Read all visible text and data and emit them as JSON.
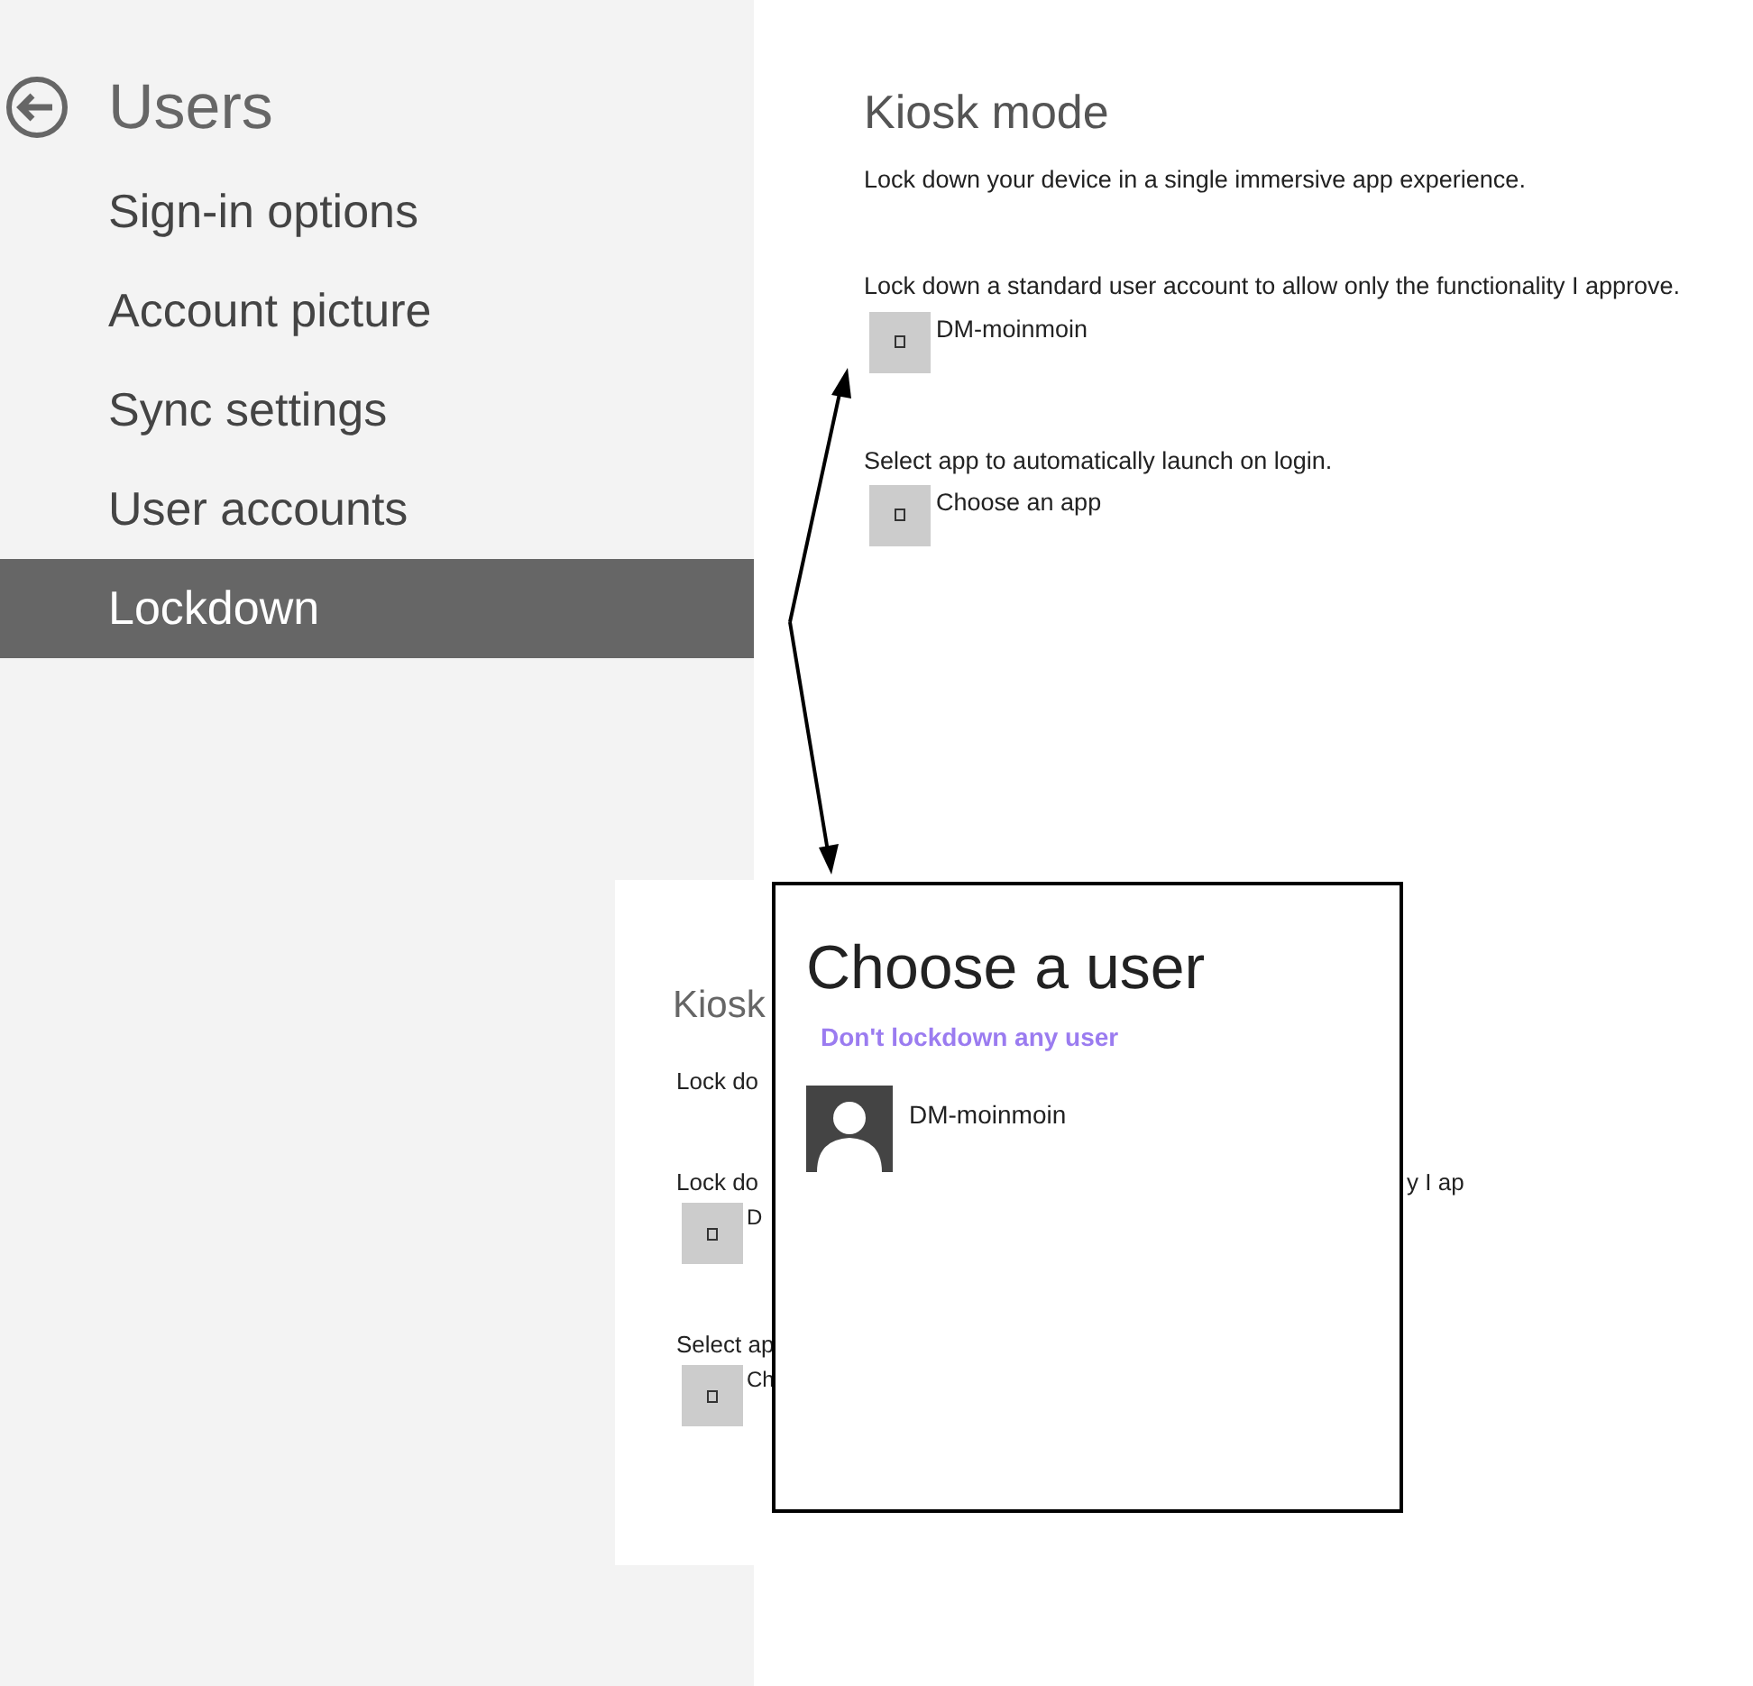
{
  "sidebar": {
    "title": "Users",
    "items": [
      {
        "label": "Sign-in options",
        "selected": false
      },
      {
        "label": "Account picture",
        "selected": false
      },
      {
        "label": "Sync settings",
        "selected": false
      },
      {
        "label": "User accounts",
        "selected": false
      },
      {
        "label": "Lockdown",
        "selected": true
      }
    ]
  },
  "main": {
    "title": "Kiosk mode",
    "description": "Lock down your device in a single immersive app experience.",
    "sections": [
      {
        "label": "Lock down a standard user account to allow only the functionality I approve.",
        "value": "DM-moinmoin"
      },
      {
        "label": "Select app to automatically launch on login.",
        "value": "Choose an app"
      }
    ]
  },
  "inset": {
    "title": "Kiosk",
    "description": "Lock do",
    "sections": [
      {
        "label": "Lock do",
        "label_tail": "y I ap",
        "value": "D"
      },
      {
        "label": "Select ap",
        "value": "Ch"
      }
    ]
  },
  "popup": {
    "title": "Choose a user",
    "link": "Don't lockdown any user",
    "users": [
      {
        "name": "DM-moinmoin"
      }
    ]
  }
}
